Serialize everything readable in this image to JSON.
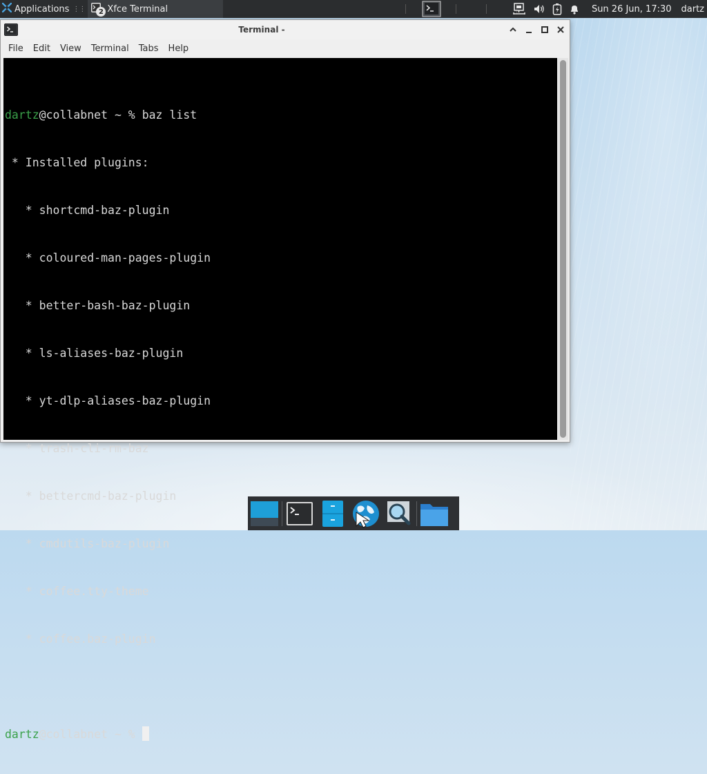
{
  "top_panel": {
    "applications_label": "Applications",
    "task_label": "Xfce Terminal",
    "task_badge": "2",
    "clock": "Sun 26 Jun, 17:30",
    "user": "dartz"
  },
  "window": {
    "title": "Terminal -",
    "menu": [
      "File",
      "Edit",
      "View",
      "Terminal",
      "Tabs",
      "Help"
    ]
  },
  "terminal": {
    "prompt_user": "dartz",
    "prompt_rest": "@collabnet ~ % ",
    "command": "baz list",
    "header": " * Installed plugins:",
    "plugins": [
      "shortcmd-baz-plugin",
      "coloured-man-pages-plugin",
      "better-bash-baz-plugin",
      "ls-aliases-baz-plugin",
      "yt-dlp-aliases-baz-plugin",
      "trash-cli-rm-baz",
      "bettercmd-baz-plugin",
      "cmdutils-baz-plugin",
      "coffee.tty-theme",
      "coffee.baz-plugin"
    ],
    "bullet": "   * ",
    "colors": {
      "prompt_user": "#3aa14a",
      "background": "#000000",
      "text": "#d9d9d9"
    }
  },
  "dock": {
    "items": [
      "show-desktop",
      "terminal",
      "file-manager-drawer",
      "web-browser",
      "app-finder",
      "home-folder"
    ]
  }
}
